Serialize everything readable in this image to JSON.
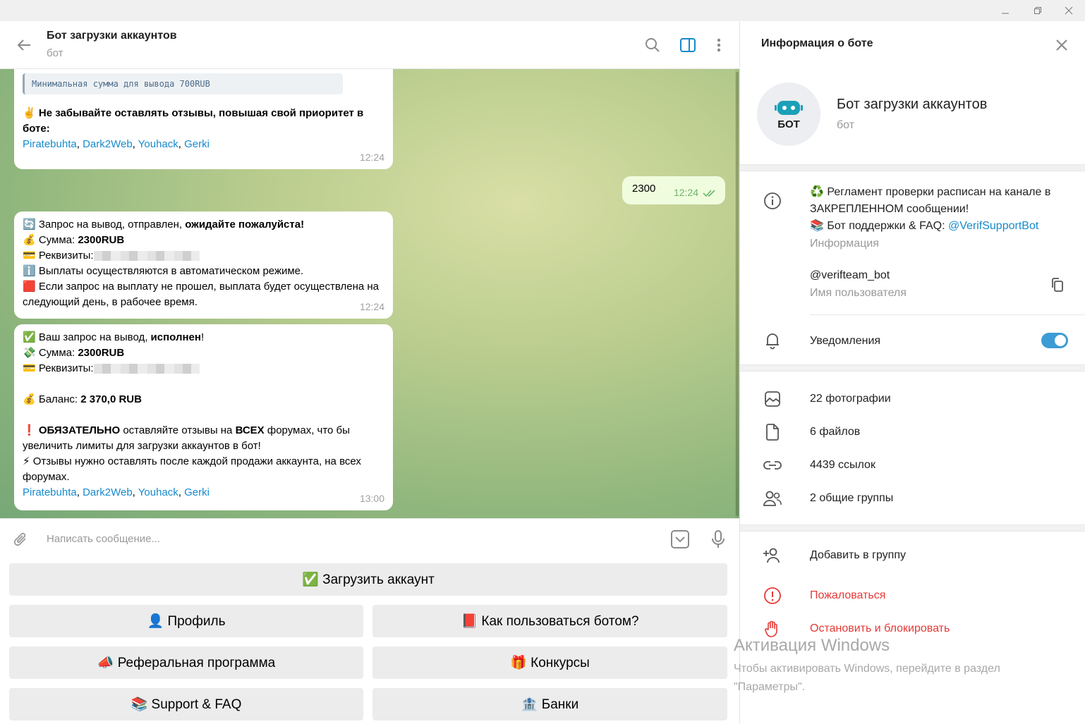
{
  "chat": {
    "title": "Бот загрузки аккаунтов",
    "subtitle": "бот"
  },
  "messages": {
    "m1": {
      "code_line": "Минимальная сумма для вывода 700RUB",
      "emoji": "✌️",
      "bold": "Не забывайте оставлять отзывы, повышая свой приоритет в боте:",
      "links": [
        "Piratebuhta",
        "Dark2Web",
        "Youhack",
        "Gerki"
      ],
      "time": "12:24"
    },
    "out1": {
      "text": "2300",
      "time": "12:24"
    },
    "m2": {
      "l1_emoji": "🔄",
      "l1_text": "Запрос на вывод,  отправлен, ",
      "l1_bold": "ожидайте пожалуйста!",
      "l2_emoji": "💰",
      "l2_text": "Сумма: ",
      "l2_bold": "2300RUB",
      "l3_emoji": "💳",
      "l3_text": "Реквизиты:",
      "l4_emoji": "ℹ️",
      "l4_text": "Выплаты осуществляются в автоматическом режиме.",
      "l5_emoji": "🟥",
      "l5_text": "Если запрос на выплату не прошел, выплата будет осуществлена на следующий день, в рабочее время.",
      "time": "12:24"
    },
    "m3": {
      "l1_emoji": "✅",
      "l1_text": "Ваш запрос на вывод, ",
      "l1_bold": "исполнен",
      "l1_end": "!",
      "l2_emoji": "💸",
      "l2_text": "Сумма: ",
      "l2_bold": "2300RUB",
      "l3_emoji": "💳",
      "l3_text": "Реквизиты:",
      "l4_emoji": "💰",
      "l4_text": "Баланс: ",
      "l4_bold": "2 370,0 RUB",
      "l5_emoji": "❗",
      "l5_bold1": "ОБЯЗАТЕЛЬНО",
      "l5_text1": " оставляйте отзывы на ",
      "l5_bold2": "ВСЕХ",
      "l5_text2": " форумах, что бы увеличить лимиты для загрузки аккаунтов в бот!",
      "l6_emoji": "⚡",
      "l6_text": "Отзывы нужно оставлять после каждой продажи аккаунта, на всех форумах.",
      "links": [
        "Piratebuhta",
        "Dark2Web",
        "Youhack",
        "Gerki"
      ],
      "time": "13:00"
    }
  },
  "composer": {
    "placeholder": "Написать сообщение..."
  },
  "keyboard": {
    "upload": "✅ Загрузить аккаунт",
    "profile": "👤 Профиль",
    "howto": "📕 Как пользоваться ботом?",
    "referral": "📣 Реферальная программа",
    "contests": "🎁 Конкурсы",
    "support": "📚 Support & FAQ",
    "banks": "🏦 Банки"
  },
  "panel": {
    "title": "Информация о боте",
    "avatar_label": "БОТ",
    "name": "Бот загрузки аккаунтов",
    "subtitle": "бот",
    "info_line1": "♻️ Регламент проверки расписан на канале в ЗАКРЕПЛЕННОМ сообщении!",
    "info_line2": "📚 Бот поддержки & FAQ: ",
    "info_link": "@VerifSupportBot",
    "info_caption": "Информация",
    "username": "@verifteam_bot",
    "username_caption": "Имя пользователя",
    "notifications": "Уведомления",
    "notifications_on": true,
    "photos": "22 фотографии",
    "files": "6 файлов",
    "links": "4439 ссылок",
    "groups": "2 общие группы",
    "add_group": "Добавить в группу",
    "report": "Пожаловаться",
    "block": "Остановить и блокировать"
  },
  "watermark": {
    "title": "Активация Windows",
    "text": "Чтобы активировать Windows, перейдите в раздел \"Параметры\"."
  },
  "colors": {
    "accent": "#168acd",
    "danger": "#e53935",
    "outgoing_bubble": "#effdde"
  }
}
